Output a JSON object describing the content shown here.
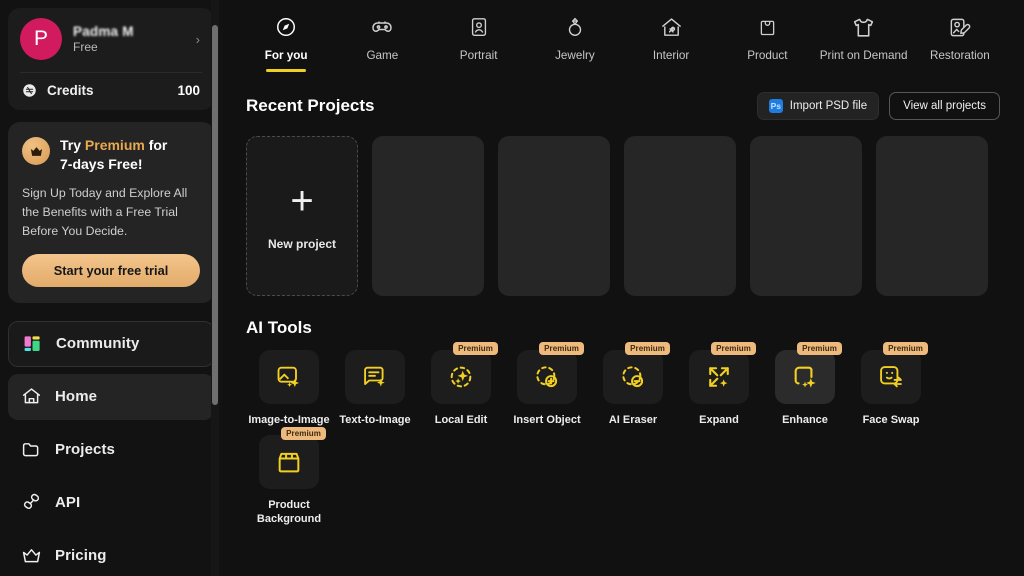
{
  "sidebar": {
    "profile": {
      "avatar_initial": "P",
      "name": "Padma M",
      "plan": "Free",
      "chevron": "chevron-right-icon"
    },
    "credits": {
      "label": "Credits",
      "value": "100",
      "icon": "coin-icon"
    },
    "promo": {
      "icon": "crown-icon",
      "title_pre": "Try ",
      "title_highlight": "Premium",
      "title_post": " for",
      "title_line2": "7-days Free!",
      "body": "Sign Up Today and Explore All the Benefits with a Free Trial Before You Decide.",
      "button": "Start your free trial"
    },
    "nav": [
      {
        "label": "Community",
        "icon": "community-blocks-icon",
        "active": false,
        "outlined": true
      },
      {
        "label": "Home",
        "icon": "home-icon",
        "active": true,
        "outlined": false
      },
      {
        "label": "Projects",
        "icon": "folder-icon",
        "active": false,
        "outlined": false
      },
      {
        "label": "API",
        "icon": "api-link-icon",
        "active": false,
        "outlined": false
      },
      {
        "label": "Pricing",
        "icon": "crown-outline-icon",
        "active": false,
        "outlined": false
      }
    ]
  },
  "tabs": [
    {
      "label": "For you",
      "icon": "compass-icon",
      "active": true
    },
    {
      "label": "Game",
      "icon": "gamepad-icon",
      "active": false
    },
    {
      "label": "Portrait",
      "icon": "portrait-icon",
      "active": false
    },
    {
      "label": "Jewelry",
      "icon": "ring-icon",
      "active": false
    },
    {
      "label": "Interior",
      "icon": "house-interior-icon",
      "active": false
    },
    {
      "label": "Product",
      "icon": "shopping-bag-icon",
      "active": false
    },
    {
      "label": "Print on Demand",
      "icon": "tshirt-icon",
      "active": false
    },
    {
      "label": "Restoration",
      "icon": "photo-restore-icon",
      "active": false
    }
  ],
  "recent_projects": {
    "title": "Recent Projects",
    "import_button": "Import PSD file",
    "import_icon": "photoshop-icon",
    "view_all_button": "View all projects",
    "new_project_label": "New project",
    "new_project_icon": "plus-icon",
    "placeholder_count": 5
  },
  "ai_tools": {
    "title": "AI Tools",
    "items": [
      {
        "label": "Image-to-Image",
        "icon": "image-sparkle-icon",
        "premium": false,
        "highlighted": false
      },
      {
        "label": "Text-to-Image",
        "icon": "text-sparkle-icon",
        "premium": false,
        "highlighted": false
      },
      {
        "label": "Local Edit",
        "icon": "dashed-sparkle-icon",
        "premium": true,
        "highlighted": false
      },
      {
        "label": "Insert Object",
        "icon": "dashed-plus-icon",
        "premium": true,
        "highlighted": false
      },
      {
        "label": "AI Eraser",
        "icon": "dashed-minus-icon",
        "premium": true,
        "highlighted": false
      },
      {
        "label": "Expand",
        "icon": "expand-arrows-icon",
        "premium": true,
        "highlighted": false
      },
      {
        "label": "Enhance",
        "icon": "square-sparkle-icon",
        "premium": true,
        "highlighted": true
      },
      {
        "label": "Face Swap",
        "icon": "face-swap-icon",
        "premium": true,
        "highlighted": false
      },
      {
        "label": "Product Background",
        "icon": "product-box-icon",
        "premium": true,
        "highlighted": false
      }
    ],
    "premium_badge_label": "Premium"
  },
  "colors": {
    "accent_yellow": "#f2d021",
    "premium_badge": "#edb97c",
    "avatar_pink": "#d21b5f",
    "gold_text": "#e7a84f",
    "photoshop_blue": "#1f7ce0",
    "background": "#111111",
    "sidebar_background": "#121212"
  }
}
